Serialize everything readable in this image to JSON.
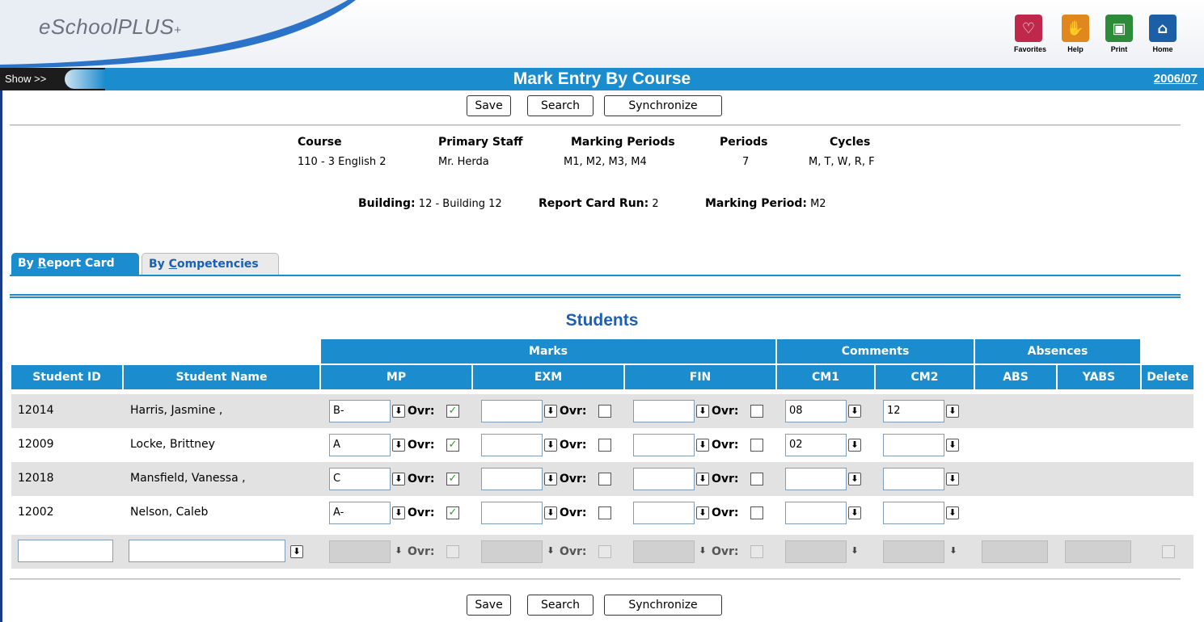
{
  "header": {
    "logo": "eSchoolPLUS",
    "logo_plus": "+",
    "icons": [
      {
        "name": "favorites",
        "label": "Favorites",
        "color": "#c0284b",
        "glyph": "♡"
      },
      {
        "name": "help",
        "label": "Help",
        "color": "#e0881c",
        "glyph": "✋"
      },
      {
        "name": "print",
        "label": "Print",
        "color": "#2e8b3a",
        "glyph": "▣"
      },
      {
        "name": "home",
        "label": "Home",
        "color": "#1d5fa6",
        "glyph": "⌂"
      }
    ]
  },
  "titlebar": {
    "show": "Show >>",
    "title": "Mark Entry By Course",
    "year": "2006/07"
  },
  "toolbar": {
    "save": "Save",
    "search": "Search",
    "synchronize": "Synchronize"
  },
  "info": {
    "course_h": "Course",
    "course_v": "110 - 3 English 2",
    "staff_h": "Primary Staff",
    "staff_v": "Mr. Herda",
    "mp_h": "Marking Periods",
    "mp_v": "M1, M2, M3, M4",
    "periods_h": "Periods",
    "periods_v": "7",
    "cycles_h": "Cycles",
    "cycles_v": "M, T, W, R, F",
    "building_l": "Building:",
    "building_v": "12 - Building 12",
    "rcr_l": "Report Card Run:",
    "rcr_v": "2",
    "markp_l": "Marking Period:",
    "markp_v": "M2"
  },
  "tabs": {
    "report_card_a": "By ",
    "report_card_u": "R",
    "report_card_b": "eport Card",
    "competencies_a": "By ",
    "competencies_u": "C",
    "competencies_b": "ompetencies"
  },
  "section_title": "Students",
  "groups": {
    "marks": "Marks",
    "comments": "Comments",
    "absences": "Absences"
  },
  "columns": {
    "student_id": "Student ID",
    "student_name": "Student Name",
    "mp": "MP",
    "exm": "EXM",
    "fin": "FIN",
    "cm1": "CM1",
    "cm2": "CM2",
    "abs": "ABS",
    "yabs": "YABS",
    "delete": "Delete"
  },
  "ovr_label": "Ovr:",
  "rows": [
    {
      "id": "12014",
      "name": "Harris, Jasmine ,",
      "mp": "B-",
      "exm": "",
      "fin": "",
      "cm1": "08",
      "cm2": "12"
    },
    {
      "id": "12009",
      "name": "Locke, Brittney",
      "mp": "A",
      "exm": "",
      "fin": "",
      "cm1": "02",
      "cm2": ""
    },
    {
      "id": "12018",
      "name": "Mansfield, Vanessa ,",
      "mp": "C",
      "exm": "",
      "fin": "",
      "cm1": "",
      "cm2": ""
    },
    {
      "id": "12002",
      "name": "Nelson, Caleb",
      "mp": "A-",
      "exm": "",
      "fin": "",
      "cm1": "",
      "cm2": ""
    }
  ]
}
